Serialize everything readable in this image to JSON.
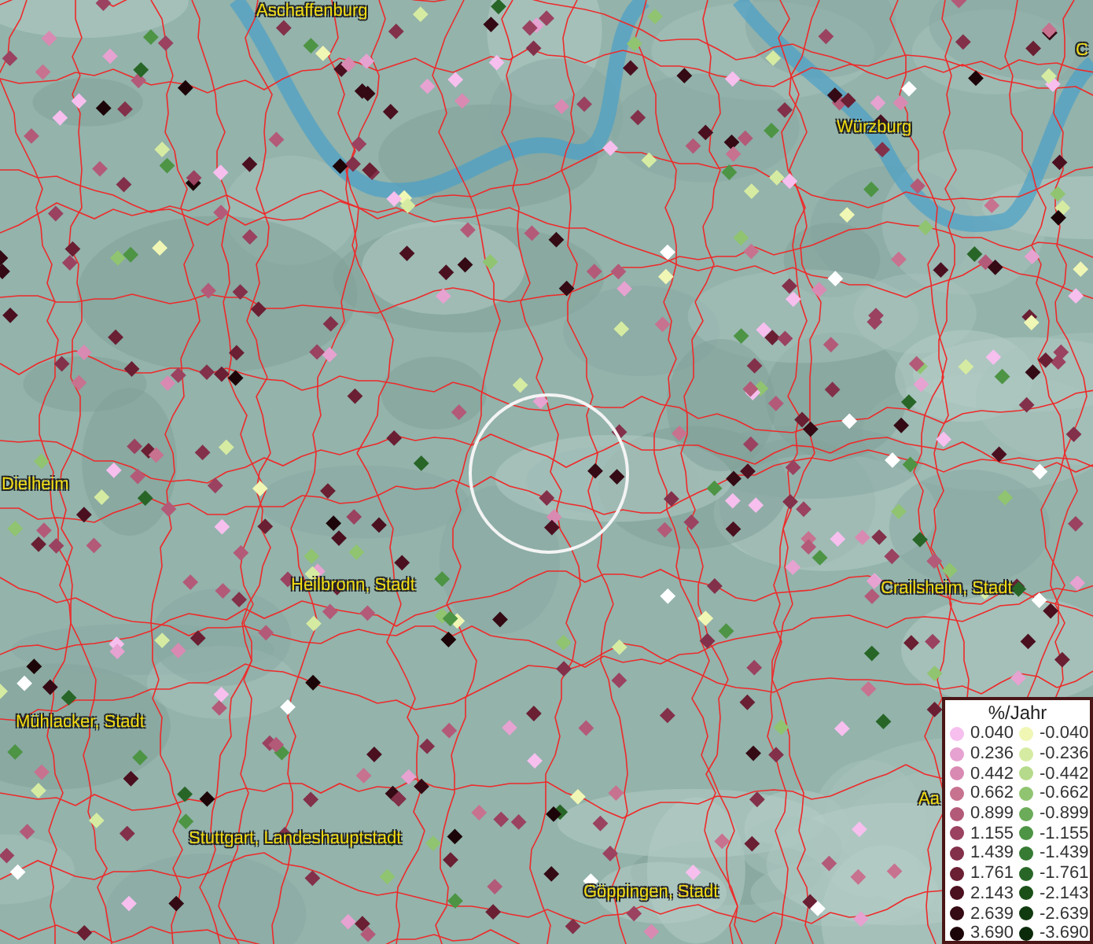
{
  "map": {
    "places": [
      {
        "name": "Aschaffenburg"
      },
      {
        "name": "Würzburg"
      },
      {
        "name": "C"
      },
      {
        "name": "Dielheim"
      },
      {
        "name": "Heilbronn, Stadt"
      },
      {
        "name": "Crailsheim, Stadt"
      },
      {
        "name": "Mühlacker, Stadt"
      },
      {
        "name": "Aa"
      },
      {
        "name": "Stuttgart, Landeshauptstadt"
      },
      {
        "name": "Göppingen, Stadt"
      }
    ]
  },
  "legend": {
    "title": "%/Jahr",
    "positive": [
      {
        "label": "0.040",
        "color": "#f6bfee"
      },
      {
        "label": "0.236",
        "color": "#e6a2d0"
      },
      {
        "label": "0.442",
        "color": "#d98ab2"
      },
      {
        "label": "0.662",
        "color": "#c7728f"
      },
      {
        "label": "0.899",
        "color": "#b35a78"
      },
      {
        "label": "1.155",
        "color": "#9a4260"
      },
      {
        "label": "1.439",
        "color": "#83304a"
      },
      {
        "label": "1.761",
        "color": "#6a1f33"
      },
      {
        "label": "2.143",
        "color": "#4b1020"
      },
      {
        "label": "2.639",
        "color": "#340a14"
      },
      {
        "label": "3.690",
        "color": "#1c0508"
      }
    ],
    "negative": [
      {
        "label": "-0.040",
        "color": "#f0f6b4"
      },
      {
        "label": "-0.236",
        "color": "#d6eba2"
      },
      {
        "label": "-0.442",
        "color": "#b6da8b"
      },
      {
        "label": "-0.662",
        "color": "#90c470"
      },
      {
        "label": "-0.899",
        "color": "#6bab59"
      },
      {
        "label": "-1.155",
        "color": "#4d9444"
      },
      {
        "label": "-1.439",
        "color": "#367a33"
      },
      {
        "label": "-1.761",
        "color": "#286628"
      },
      {
        "label": "-2.143",
        "color": "#1a5018"
      },
      {
        "label": "-2.639",
        "color": "#103a10"
      },
      {
        "label": "-3.690",
        "color": "#0a2a0a"
      }
    ]
  }
}
